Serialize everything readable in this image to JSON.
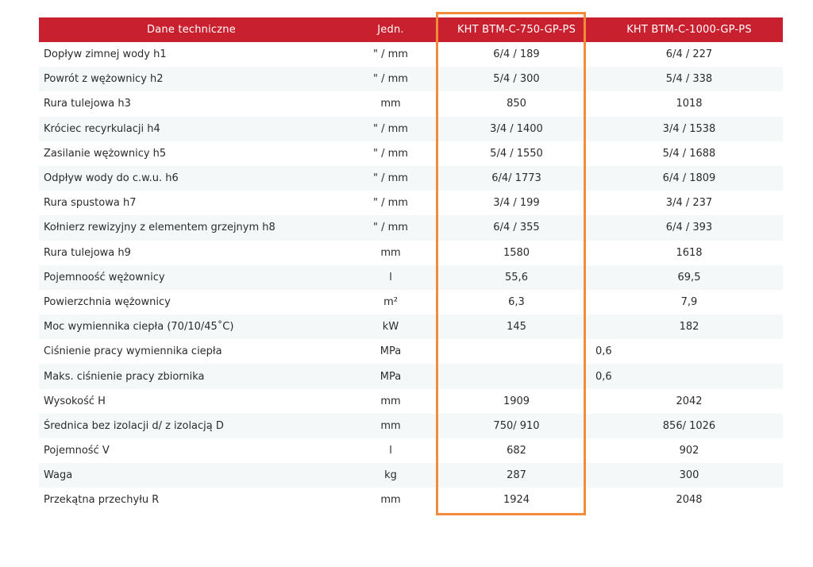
{
  "table": {
    "headers": [
      "Dane techniczne",
      "Jedn.",
      "KHT BTM-C-750-GP-PS",
      "KHT BTM-C-1000-GP-PS"
    ],
    "rows": [
      {
        "name": "Dopływ zimnej wody h1",
        "unit": "\" / mm",
        "v750": "6/4 / 189",
        "v1000": "6/4 / 227"
      },
      {
        "name": "Powrót z wężownicy h2",
        "unit": "\" / mm",
        "v750": "5/4 / 300",
        "v1000": "5/4 / 338"
      },
      {
        "name": "Rura tulejowa h3",
        "unit": "mm",
        "v750": "850",
        "v1000": "1018"
      },
      {
        "name": "Króciec recyrkulacji h4",
        "unit": "\" / mm",
        "v750": "3/4 / 1400",
        "v1000": "3/4 / 1538"
      },
      {
        "name": "Zasilanie wężownicy h5",
        "unit": "\" / mm",
        "v750": "5/4 / 1550",
        "v1000": "5/4 / 1688"
      },
      {
        "name": "Odpływ wody do c.w.u. h6",
        "unit": "\" / mm",
        "v750": "6/4/ 1773",
        "v1000": "6/4 / 1809"
      },
      {
        "name": "Rura spustowa h7",
        "unit": "\" / mm",
        "v750": "3/4 / 199",
        "v1000": "3/4 / 237"
      },
      {
        "name": "Kołnierz rewizyjny z elementem grzejnym h8",
        "unit": "\" / mm",
        "v750": "6/4 / 355",
        "v1000": "6/4 / 393"
      },
      {
        "name": "Rura tulejowa h9",
        "unit": "mm",
        "v750": "1580",
        "v1000": "1618"
      },
      {
        "name": "Pojemnoość wężownicy",
        "unit": "l",
        "v750": "55,6",
        "v1000": "69,5"
      },
      {
        "name": "Powierzchnia wężownicy",
        "unit": "m²",
        "v750": "6,3",
        "v1000": "7,9"
      },
      {
        "name": "Moc wymiennika ciepła (70/10/45˚C)",
        "unit": "kW",
        "v750": "145",
        "v1000": "182"
      },
      {
        "name": "Ciśnienie pracy wymiennika ciepła",
        "unit": "MPa",
        "v750": "",
        "v1000": "0,6",
        "shared": true
      },
      {
        "name": "Maks. ciśnienie pracy zbiornika",
        "unit": "MPa",
        "v750": "",
        "v1000": "0,6",
        "shared": true
      },
      {
        "name": "Wysokość H",
        "unit": "mm",
        "v750": "1909",
        "v1000": "2042"
      },
      {
        "name": "Średnica bez izolacji d/ z izolacją D",
        "unit": "mm",
        "v750": "750/ 910",
        "v1000": "856/ 1026"
      },
      {
        "name": "Pojemność V",
        "unit": "l",
        "v750": "682",
        "v1000": "902"
      },
      {
        "name": "Waga",
        "unit": "kg",
        "v750": "287",
        "v1000": "300"
      },
      {
        "name": "Przekątna przechyłu R",
        "unit": "mm",
        "v750": "1924",
        "v1000": "2048"
      }
    ]
  },
  "colors": {
    "header_bg": "#c8202f",
    "header_text": "#ffffff",
    "stripe": "#f5f8f8",
    "highlight_border": "#f28b3a"
  }
}
